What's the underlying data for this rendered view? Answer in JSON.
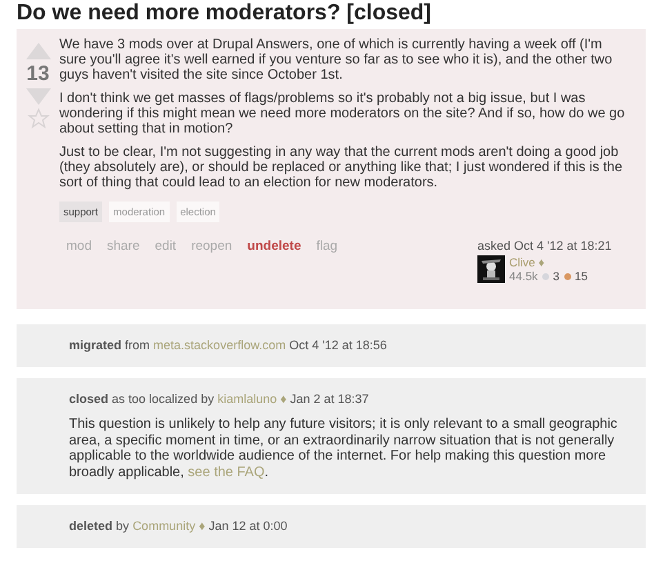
{
  "title": "Do we need more moderators? [closed]",
  "post": {
    "votes": {
      "score": "13"
    },
    "paragraphs": [
      "We have 3 mods over at Drupal Answers, one of which is currently having a week off (I'm sure you'll agree it's well earned if you venture so far as to see who it is), and the other two guys haven't visited the site since October 1st.",
      "I don't think we get masses of flags/problems so it's probably not a big issue, but I was wondering if this might mean we need more moderators on the site? And if so, how do we go about setting that in motion?",
      "Just to be clear, I'm not suggesting in any way that the current mods aren't doing a good job (they absolutely are), or should be replaced or anything like that; I just wondered if this is the sort of thing that could lead to an election for new moderators."
    ],
    "tags": [
      {
        "label": "support",
        "kind": "required"
      },
      {
        "label": "moderation",
        "kind": "normal"
      },
      {
        "label": "election",
        "kind": "normal"
      }
    ],
    "actions": [
      {
        "label": "mod",
        "highlighted": false
      },
      {
        "label": "share",
        "highlighted": false
      },
      {
        "label": "edit",
        "highlighted": false
      },
      {
        "label": "reopen",
        "highlighted": false
      },
      {
        "label": "undelete",
        "highlighted": true
      },
      {
        "label": "flag",
        "highlighted": false
      }
    ],
    "asked": "asked Oct 4 '12 at 18:21",
    "user": {
      "name": "Clive",
      "mod_mark": "♦",
      "reputation": "44.5k",
      "badges": [
        {
          "count": "3",
          "color": "#d6d6dc"
        },
        {
          "count": "15",
          "color": "#d99762"
        }
      ]
    }
  },
  "notices": [
    {
      "verb": "migrated",
      "before": "from",
      "link": "meta.stackoverflow.com",
      "after": "Oct 4 '12 at 18:56"
    },
    {
      "verb": "closed",
      "before": "as too localized by",
      "link": "kiamlaluno",
      "mod_mark": "♦",
      "after": "Jan 2 at 18:37",
      "body": "This question is unlikely to help any future visitors; it is only relevant to a small geographic area, a specific moment in time, or an extraordinarily narrow situation that is not generally applicable to the worldwide audience of the internet. For help making this question more broadly applicable,",
      "body_link": "see the FAQ",
      "body_end": "."
    },
    {
      "verb": "deleted",
      "before": "by",
      "link": "Community",
      "mod_mark": "♦",
      "after": "Jan 12 at 0:00"
    }
  ]
}
